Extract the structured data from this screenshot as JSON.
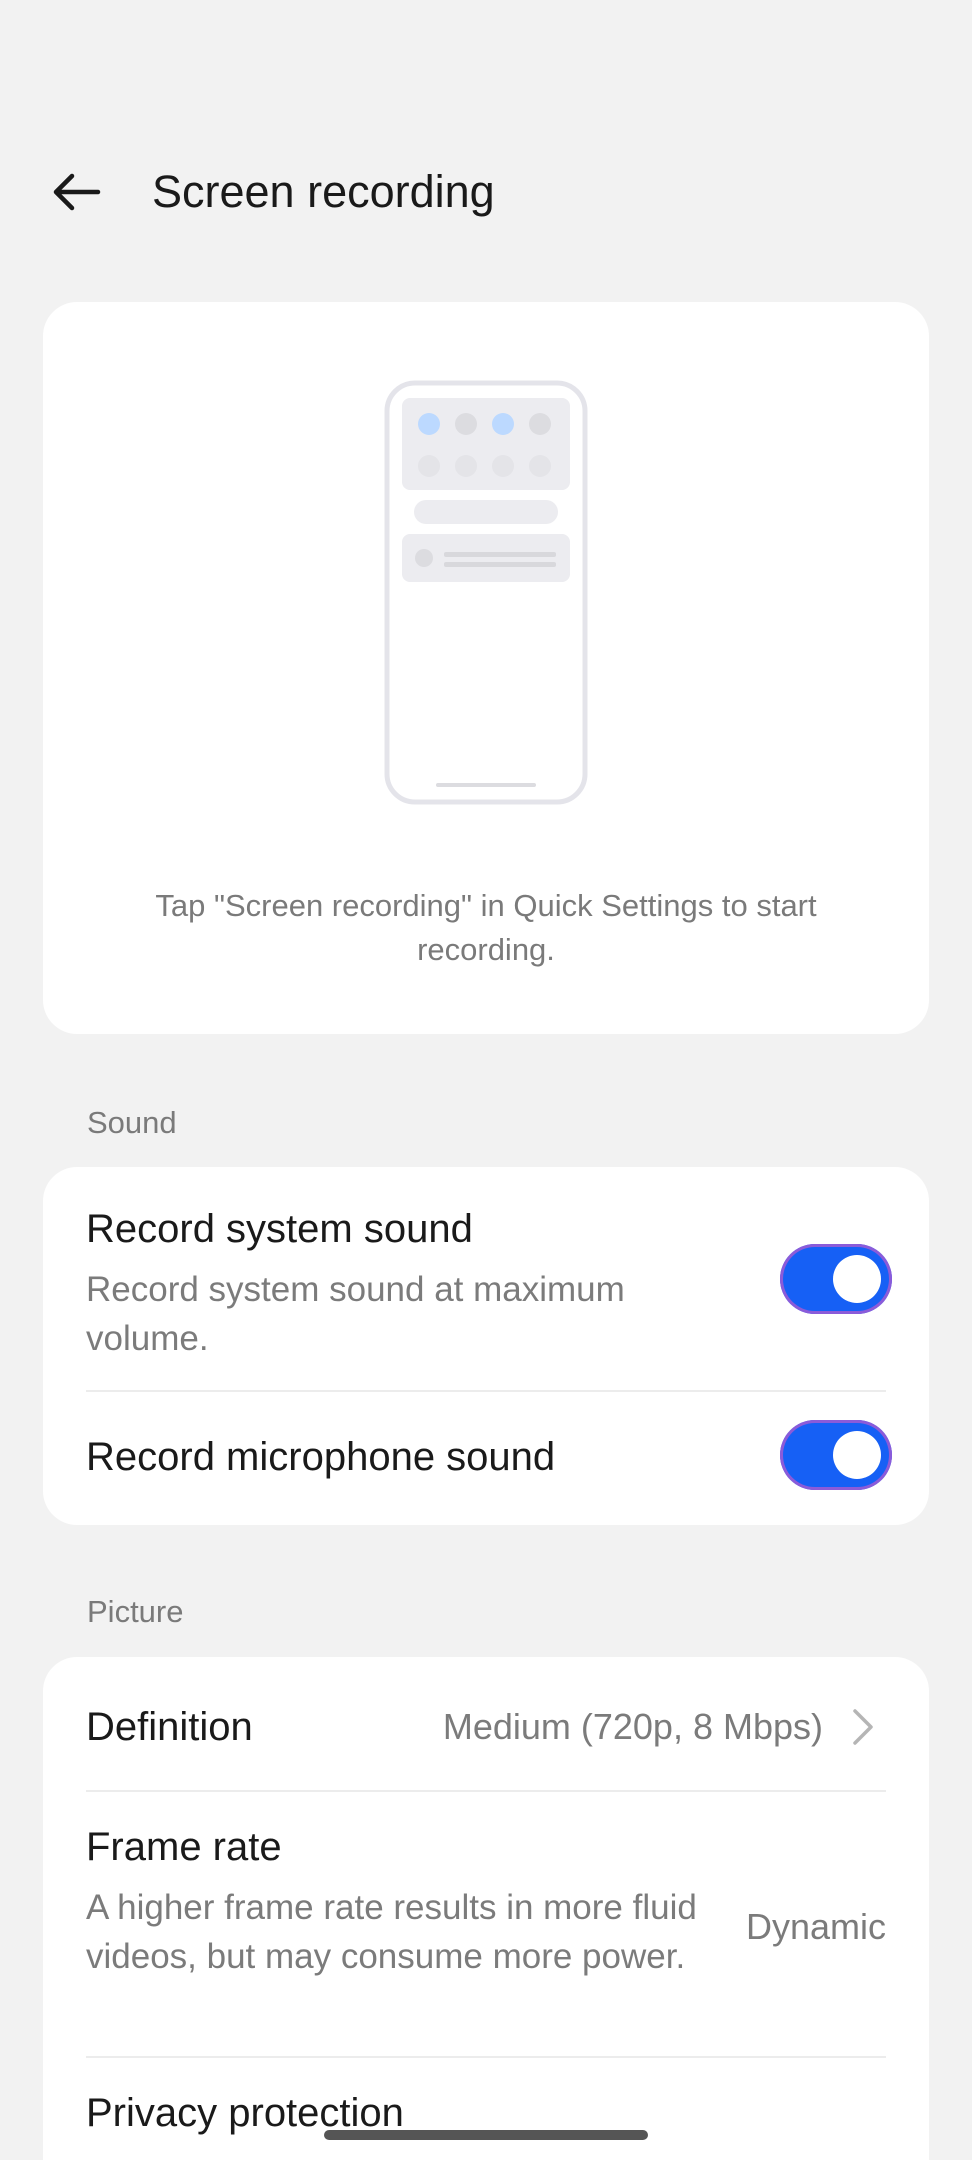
{
  "header": {
    "back_icon": "arrow-left-icon",
    "title": "Screen recording"
  },
  "hero": {
    "illustration": "phone-quick-settings-illustration",
    "caption": "Tap \"Screen recording\" in Quick Settings to start recording."
  },
  "sections": {
    "sound": {
      "label": "Sound",
      "record_system_sound": {
        "title": "Record system sound",
        "subtitle": "Record system sound at maximum volume.",
        "enabled": true
      },
      "record_microphone_sound": {
        "title": "Record microphone sound",
        "enabled": true
      }
    },
    "picture": {
      "label": "Picture",
      "definition": {
        "title": "Definition",
        "value": "Medium (720p, 8 Mbps)",
        "icon": "chevron-right-icon"
      },
      "frame_rate": {
        "title": "Frame rate",
        "subtitle": "A higher frame rate results in more fluid videos, but may consume more power.",
        "value": "Dynamic"
      },
      "privacy_protection": {
        "title": "Privacy protection"
      }
    }
  },
  "colors": {
    "background": "#f2f2f2",
    "card": "#ffffff",
    "toggle_on": "#1660f5",
    "secondary_text": "#7b7b7b"
  }
}
